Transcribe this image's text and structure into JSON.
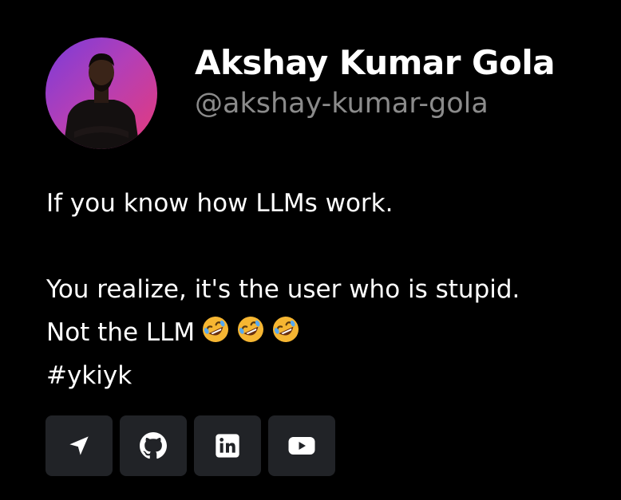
{
  "profile": {
    "name": "Akshay Kumar Gola",
    "handle": "@akshay-kumar-gola"
  },
  "post": {
    "line1": "If you know how LLMs work.",
    "line2": "You realize, it's the user who is stupid.",
    "line3": "Not the LLM",
    "line3_emojis": [
      "rolling-on-floor-laughing",
      "rolling-on-floor-laughing",
      "rolling-on-floor-laughing"
    ],
    "hashtag": "#ykiyk"
  },
  "actions": [
    {
      "icon": "send-icon"
    },
    {
      "icon": "github-icon"
    },
    {
      "icon": "linkedin-icon"
    },
    {
      "icon": "youtube-icon"
    }
  ],
  "colors": {
    "background": "#000000",
    "handle": "#8b8b8b",
    "button_bg": "#212327",
    "avatar_gradient": [
      "#7a3bd9",
      "#e63a7a"
    ]
  }
}
